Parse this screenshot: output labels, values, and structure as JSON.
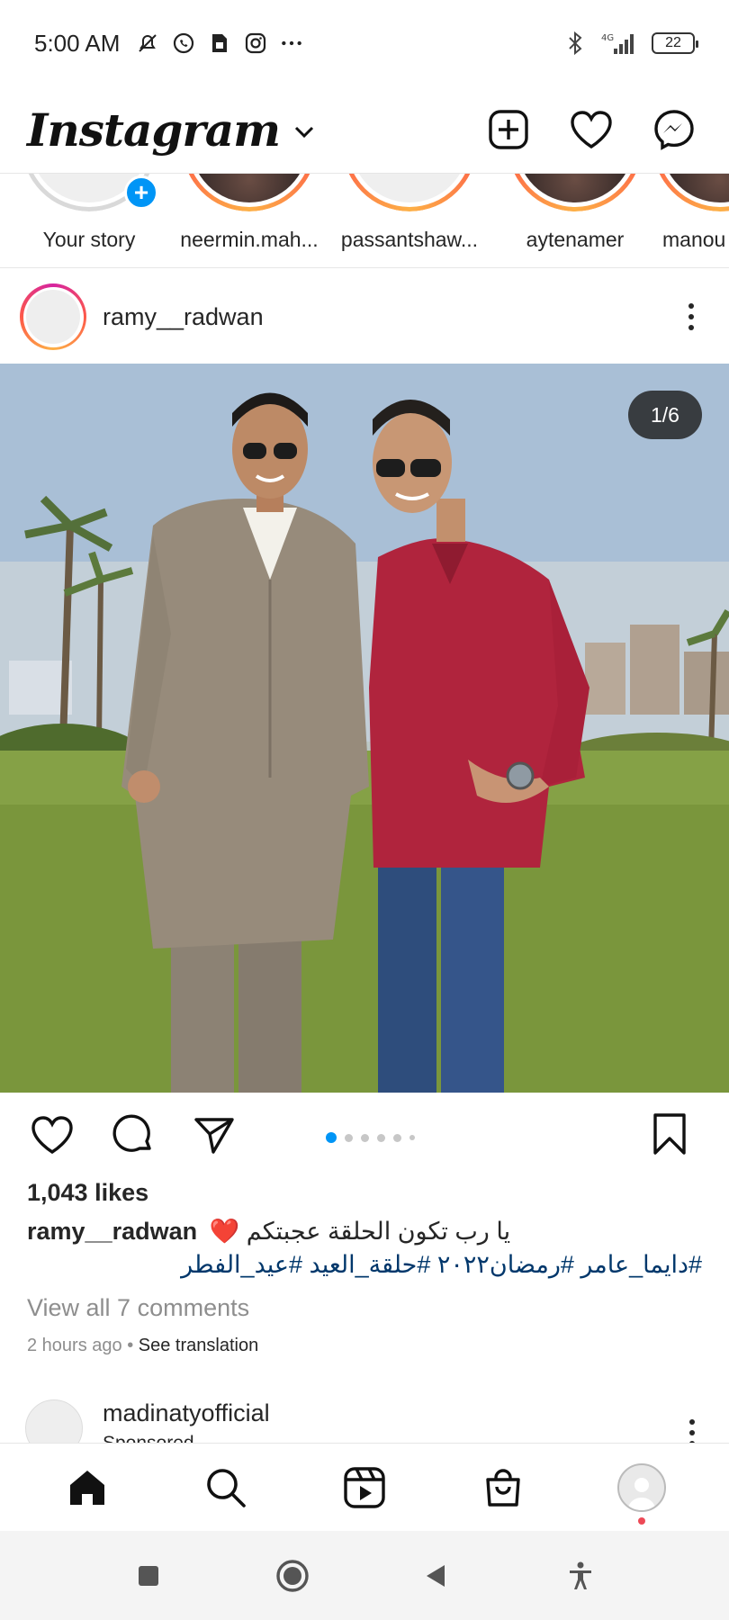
{
  "status_bar": {
    "time": "5:00 AM",
    "network": "4G",
    "battery": "22",
    "icons": [
      "mute-icon",
      "whatsapp-icon",
      "sim-icon",
      "instagram-icon",
      "more-dots-icon",
      "bluetooth-icon",
      "signal-icon",
      "battery-icon"
    ]
  },
  "header": {
    "logo": "Instagram",
    "actions": [
      "new-post-icon",
      "heart-icon",
      "messenger-icon"
    ]
  },
  "stories": [
    {
      "label": "Your story",
      "own": true
    },
    {
      "label": "neermin.mah..."
    },
    {
      "label": "passantshaw..."
    },
    {
      "label": "aytenamer"
    },
    {
      "label": "manou"
    }
  ],
  "post": {
    "username": "ramy__radwan",
    "counter": "1/6",
    "likes": "1,043 likes",
    "caption": "يا رب تكون الحلقة عجبتكم ❤️",
    "hashtags": "#دايما_عامر #رمضان٢٠٢٢ #حلقة_العيد #عيد_الفطر",
    "view_comments": "View all 7 comments",
    "time": "2 hours ago",
    "separator": "•",
    "see_translation": "See translation",
    "carousel": {
      "total": 6,
      "active": 1
    }
  },
  "next_post": {
    "username": "madinatyofficial",
    "sponsored": "Sponsored"
  },
  "bottom_nav": [
    "home-icon",
    "search-icon",
    "reels-icon",
    "shop-icon",
    "profile-icon"
  ],
  "colors": {
    "accent": "#0095f6",
    "link": "#00376b",
    "muted": "#8e8e8e",
    "notification": "#ed4956"
  }
}
